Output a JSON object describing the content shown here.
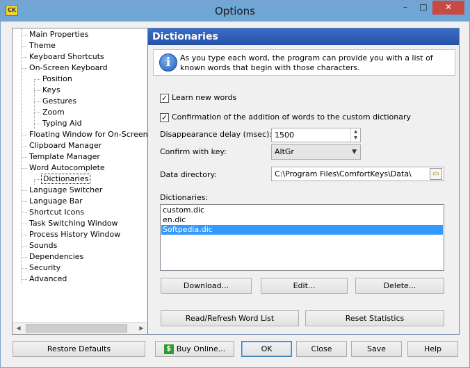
{
  "window": {
    "title": "Options",
    "app_icon_label": "CK",
    "controls": {
      "minimize": "–",
      "maximize": "□",
      "close": "✕"
    }
  },
  "tree": {
    "items": [
      {
        "label": "Main Properties",
        "level": 0
      },
      {
        "label": "Theme",
        "level": 0
      },
      {
        "label": "Keyboard Shortcuts",
        "level": 0
      },
      {
        "label": "On-Screen Keyboard",
        "level": 0
      },
      {
        "label": "Position",
        "level": 1
      },
      {
        "label": "Keys",
        "level": 1
      },
      {
        "label": "Gestures",
        "level": 1
      },
      {
        "label": "Zoom",
        "level": 1
      },
      {
        "label": "Typing Aid",
        "level": 1
      },
      {
        "label": "Floating Window for On-Screen Ke",
        "level": 0
      },
      {
        "label": "Clipboard Manager",
        "level": 0
      },
      {
        "label": "Template Manager",
        "level": 0
      },
      {
        "label": "Word Autocomplete",
        "level": 0
      },
      {
        "label": "Dictionaries",
        "level": 1
      },
      {
        "label": "Language Switcher",
        "level": 0
      },
      {
        "label": "Language Bar",
        "level": 0
      },
      {
        "label": "Shortcut Icons",
        "level": 0
      },
      {
        "label": "Task Switching Window",
        "level": 0
      },
      {
        "label": "Process History Window",
        "level": 0
      },
      {
        "label": "Sounds",
        "level": 0
      },
      {
        "label": "Dependencies",
        "level": 0
      },
      {
        "label": "Security",
        "level": 0
      },
      {
        "label": "Advanced",
        "level": 0
      }
    ],
    "selected": "Dictionaries"
  },
  "panel": {
    "header": "Dictionaries",
    "info_text": "As you type each word, the program can provide you with a list of known words that begin with those characters.",
    "learn_new_words": {
      "label": "Learn new words",
      "checked": true
    },
    "confirm_addition": {
      "label": "Confirmation of the addition of words to the custom dictionary",
      "checked": true
    },
    "disappearance_delay": {
      "label": "Disappearance delay (msec):",
      "value": "1500"
    },
    "confirm_key": {
      "label": "Confirm with key:",
      "value": "AltGr"
    },
    "data_directory": {
      "label": "Data directory:",
      "value": "C:\\Program Files\\ComfortKeys\\Data\\"
    },
    "dictionaries_label": "Dictionaries:",
    "dictionaries": [
      "custom.dic",
      "en.dic",
      "Softpedia.dic"
    ],
    "selected_dictionary": "Softpedia.dic",
    "buttons": {
      "download": "Download...",
      "edit": "Edit...",
      "delete": "Delete...",
      "refresh": "Read/Refresh Word List",
      "reset": "Reset Statistics"
    }
  },
  "footer": {
    "restore": "Restore Defaults",
    "buy": "Buy Online...",
    "ok": "OK",
    "close": "Close",
    "save": "Save",
    "help": "Help"
  },
  "colors": {
    "header_blue": "#2f5fb8",
    "selection": "#3399ff",
    "close_red": "#c74a45"
  }
}
